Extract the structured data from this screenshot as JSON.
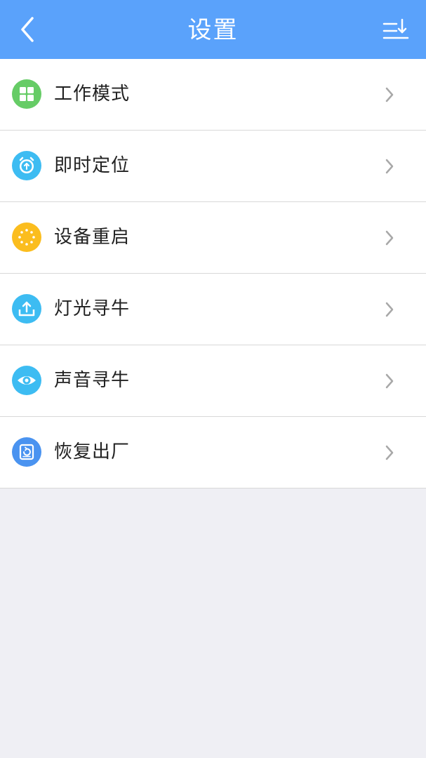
{
  "header": {
    "title": "设置",
    "back_icon": "chevron-left-icon",
    "sort_icon": "sort-descending-icon",
    "background_color": "#5aa2fb"
  },
  "settings": {
    "items": [
      {
        "label": "工作模式",
        "icon": "grid-apps-icon",
        "color": "#66cc66"
      },
      {
        "label": "即时定位",
        "icon": "alarm-clock-icon",
        "color": "#3dbcf2"
      },
      {
        "label": "设备重启",
        "icon": "loading-spinner-icon",
        "color": "#fbbd1e"
      },
      {
        "label": "灯光寻牛",
        "icon": "upload-icon",
        "color": "#3dbcf2"
      },
      {
        "label": "声音寻牛",
        "icon": "eye-icon",
        "color": "#3dbcf2"
      },
      {
        "label": "恢复出厂",
        "icon": "restore-icon",
        "color": "#4a93f0"
      }
    ]
  }
}
